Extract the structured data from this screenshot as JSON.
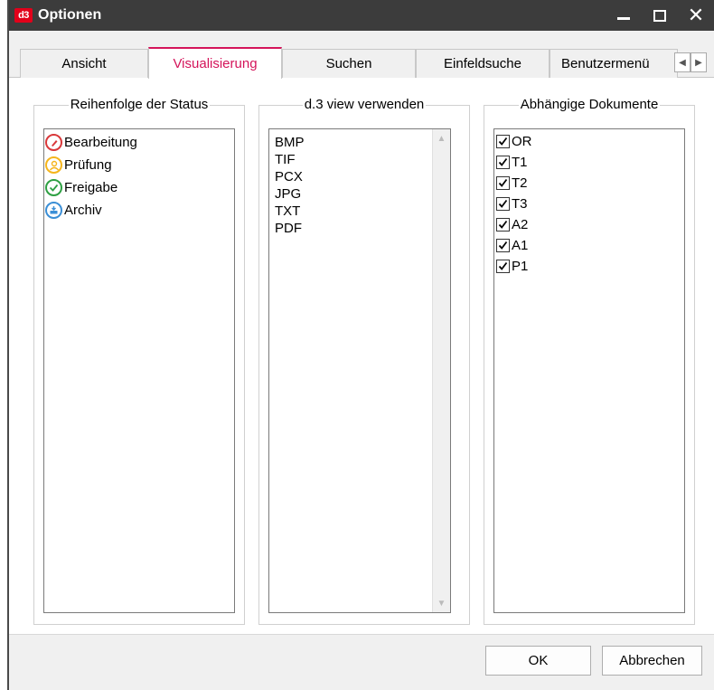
{
  "window": {
    "icon_text": "d3",
    "title": "Optionen"
  },
  "tabs": [
    {
      "label": "Ansicht"
    },
    {
      "label": "Visualisierung"
    },
    {
      "label": "Suchen"
    },
    {
      "label": "Einfeldsuche"
    },
    {
      "label": "Benutzermenü"
    }
  ],
  "groups": {
    "status": {
      "label": "Reihenfolge der Status",
      "items": [
        {
          "label": "Bearbeitung",
          "icon": "pencil-icon",
          "color": "#d9383a"
        },
        {
          "label": "Prüfung",
          "icon": "person-icon",
          "color": "#f5b51d"
        },
        {
          "label": "Freigabe",
          "icon": "check-icon",
          "color": "#2ea043"
        },
        {
          "label": "Archiv",
          "icon": "archive-icon",
          "color": "#3b8fd6"
        }
      ]
    },
    "view": {
      "label": "d.3 view verwenden",
      "items": [
        "BMP",
        "TIF",
        "PCX",
        "JPG",
        "TXT",
        "PDF"
      ]
    },
    "docs": {
      "label": "Abhängige Dokumente",
      "items": [
        {
          "label": "OR",
          "checked": true
        },
        {
          "label": "T1",
          "checked": true
        },
        {
          "label": "T2",
          "checked": true
        },
        {
          "label": "T3",
          "checked": true
        },
        {
          "label": "A2",
          "checked": true
        },
        {
          "label": "A1",
          "checked": true
        },
        {
          "label": "P1",
          "checked": true
        }
      ]
    }
  },
  "buttons": {
    "ok": "OK",
    "cancel": "Abbrechen"
  },
  "colors": {
    "accent": "#d4145a",
    "titlebar": "#3c3c3c"
  }
}
